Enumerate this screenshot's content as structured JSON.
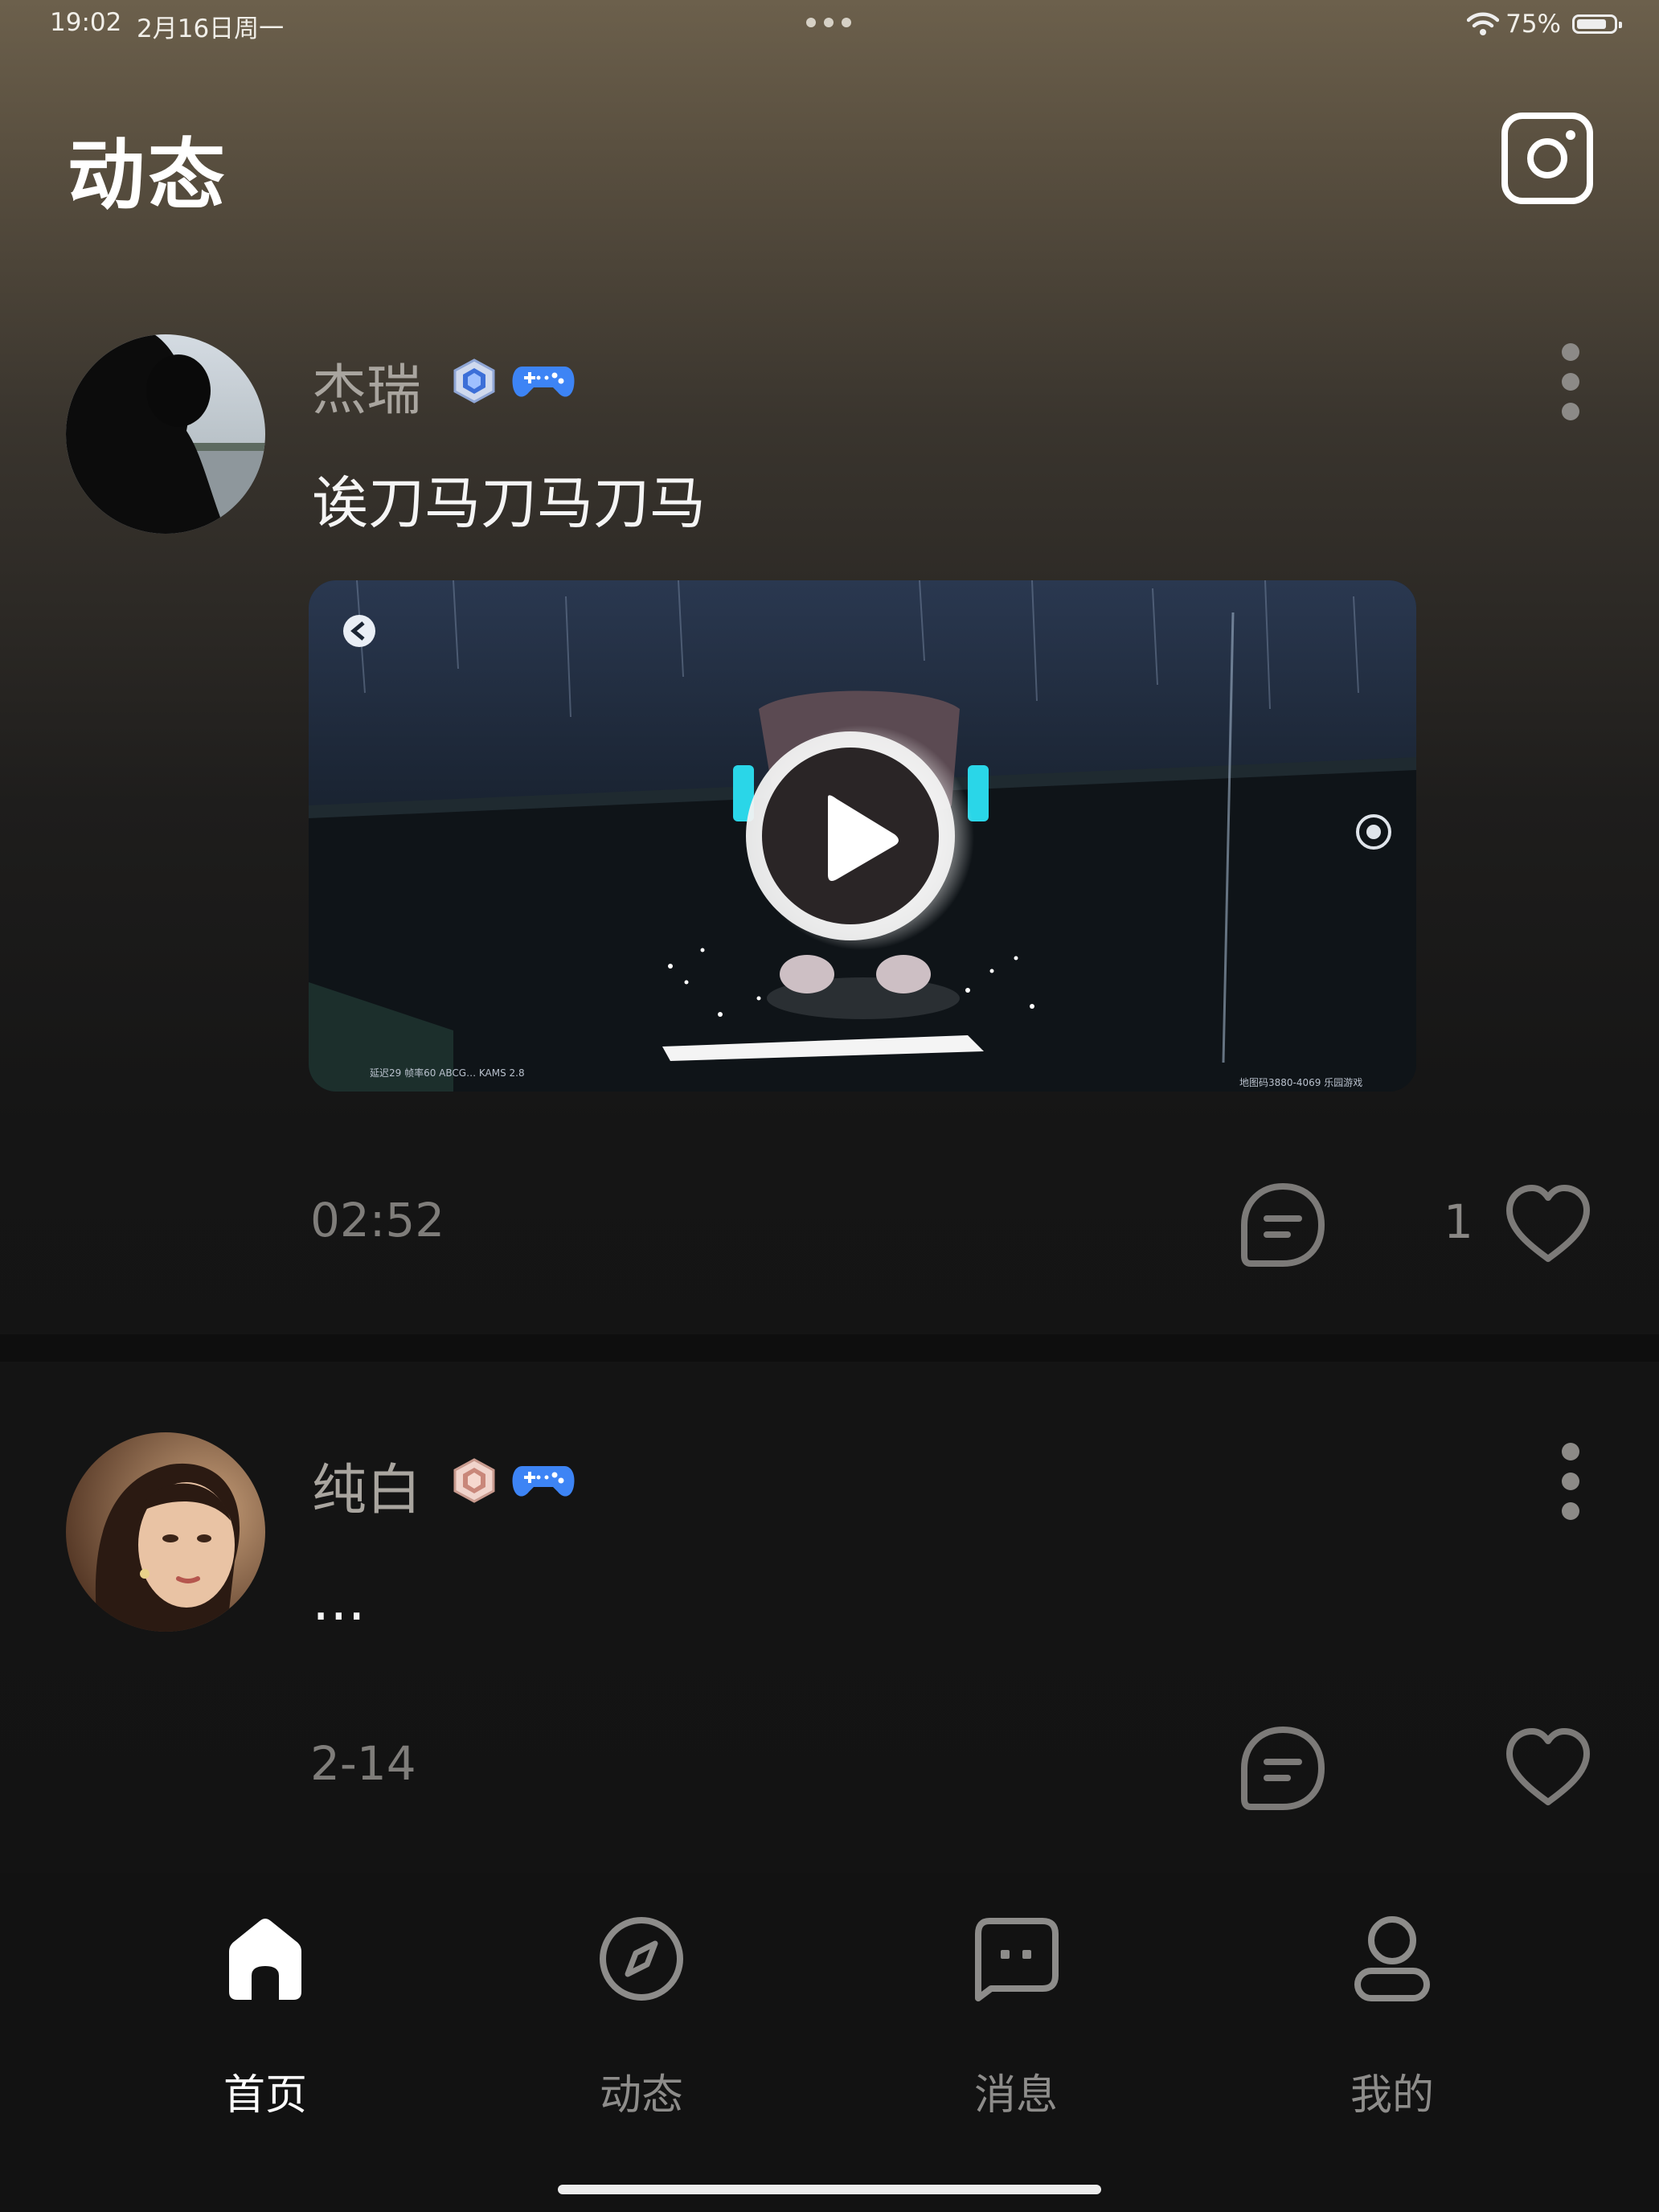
{
  "status_bar": {
    "time": "19:02",
    "date": "2月16日周一",
    "battery": "75%",
    "battery_level": 0.75
  },
  "header": {
    "title": "动态",
    "camera_icon": "camera-icon"
  },
  "posts": [
    {
      "author": "杰瑞",
      "text": "诶刀马刀马刀马",
      "date": "02:52",
      "likes": "1",
      "badges": [
        "rank-badge-icon",
        "gamepad-icon"
      ],
      "video": {
        "watermark_left": "延迟29 帧率60   ABCG… KAMS 2.8",
        "watermark_right": "地图码3880-4069 乐园游戏"
      }
    },
    {
      "author": "纯白",
      "text": "...",
      "date": "2-14",
      "likes": "",
      "badges": [
        "rank-badge-icon",
        "gamepad-icon"
      ]
    }
  ],
  "tabbar": {
    "tabs": [
      {
        "label": "首页",
        "icon": "home-icon",
        "active": true
      },
      {
        "label": "动态",
        "icon": "compass-icon",
        "active": false
      },
      {
        "label": "消息",
        "icon": "message-icon",
        "active": false
      },
      {
        "label": "我的",
        "icon": "profile-icon",
        "active": false
      }
    ]
  },
  "colors": {
    "accent_blue": "#3b82f6",
    "text_primary": "#ffffff",
    "text_secondary": "#8d8c8a"
  }
}
